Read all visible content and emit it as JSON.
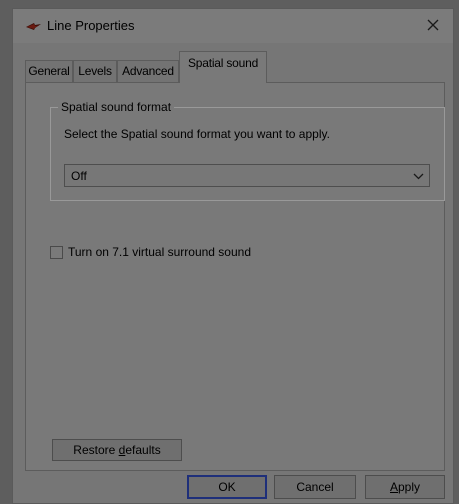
{
  "window": {
    "title": "Line Properties",
    "app_icon": "speaker-line-icon",
    "close_icon": "close-icon"
  },
  "tabs": [
    {
      "label": "General",
      "active": false
    },
    {
      "label": "Levels",
      "active": false
    },
    {
      "label": "Advanced",
      "active": false
    },
    {
      "label": "Spatial sound",
      "active": true
    }
  ],
  "spatial_sound": {
    "group_title": "Spatial sound format",
    "instruction": "Select the Spatial sound format you want to apply.",
    "format_value": "Off",
    "dropdown_icon": "chevron-down-icon"
  },
  "virtual_surround": {
    "label": "Turn on 7.1 virtual surround sound",
    "checked": false
  },
  "buttons": {
    "restore_prefix": "Restore ",
    "restore_access_key": "d",
    "restore_suffix": "efaults",
    "ok": "OK",
    "cancel": "Cancel",
    "apply_access_key": "A",
    "apply_suffix": "pply"
  },
  "colors": {
    "focus_border": "#1e2f7a",
    "icon_accent": "#6a1a10"
  }
}
